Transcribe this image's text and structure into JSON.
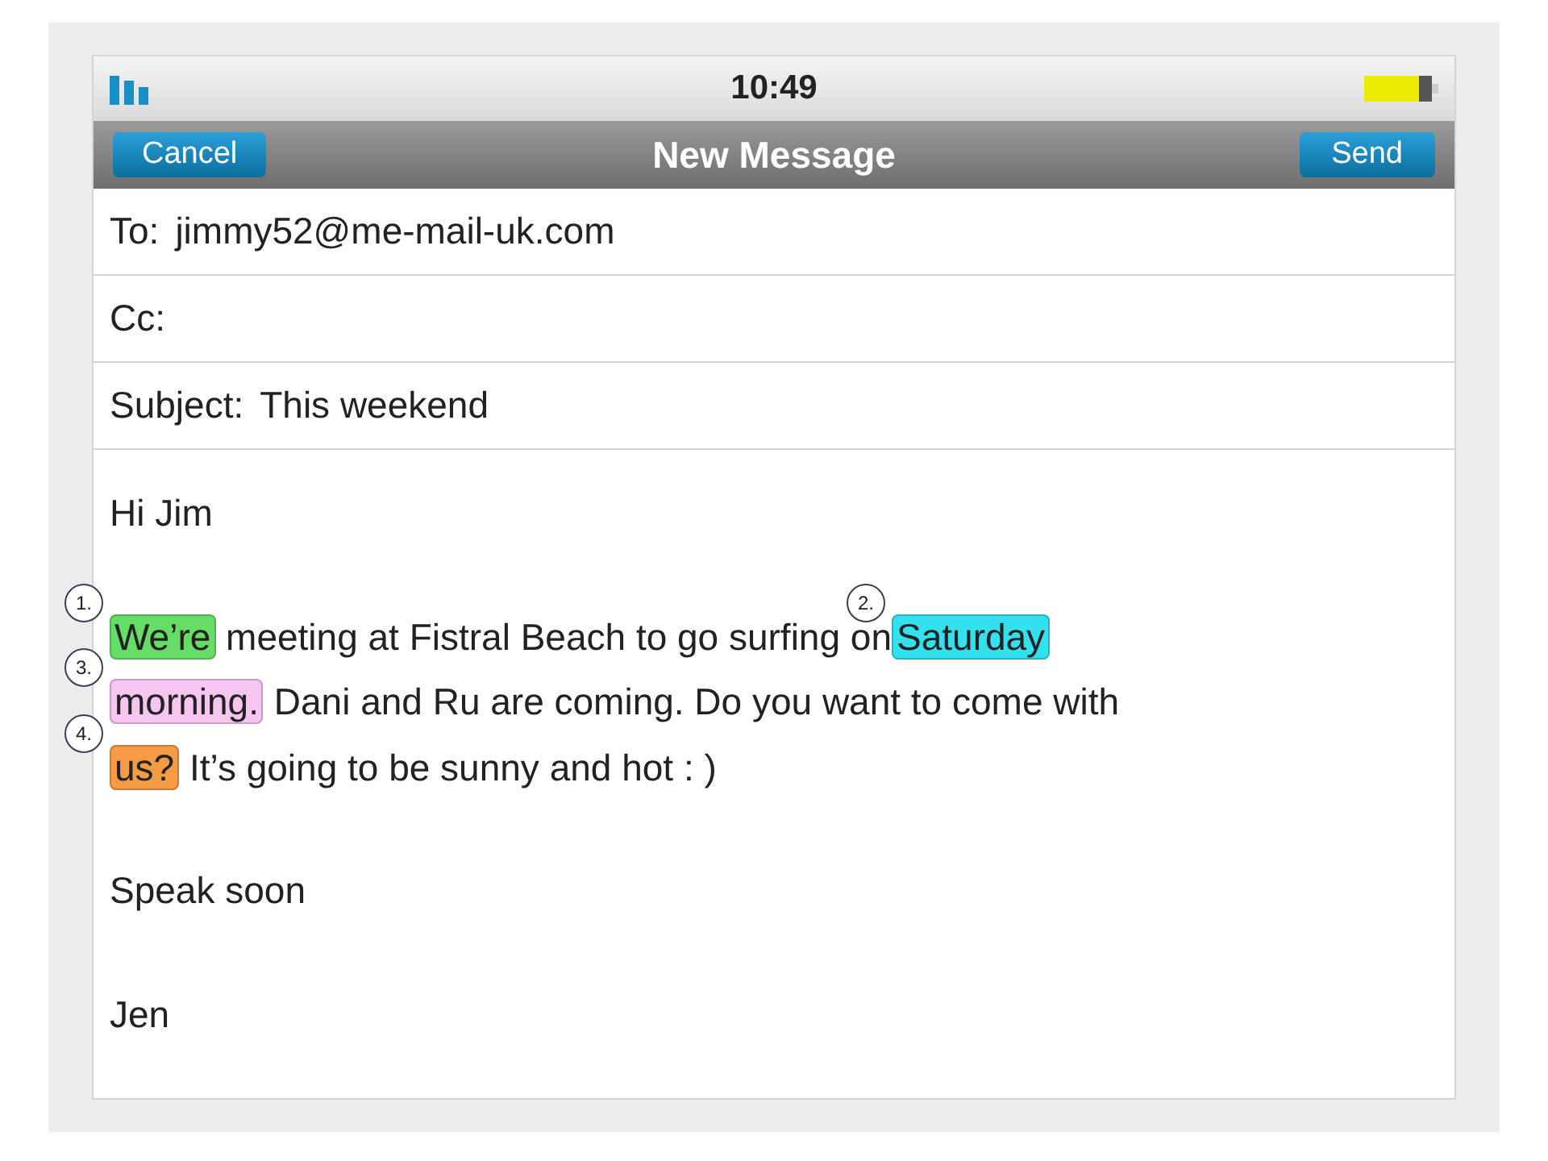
{
  "status_bar": {
    "time": "10:49"
  },
  "header": {
    "title": "New Message",
    "cancel": "Cancel",
    "send": "Send"
  },
  "fields": [
    {
      "label": "To:",
      "value": "jimmy52@me-mail-uk.com"
    },
    {
      "label": "Cc:"
    },
    {
      "label": "Subject:",
      "value": "This weekend"
    }
  ],
  "body": {
    "greeting": "Hi Jim",
    "lines": [
      [
        {
          "marker": "1.",
          "text": "We’re",
          "color": "#66dd66"
        },
        {
          "text": " meeting at Fistral Beach to go surfing on"
        },
        {
          "marker": "2.",
          "text": "Saturday",
          "color": "#33e0ee"
        }
      ],
      [
        {
          "marker": "3.",
          "text": "morning.",
          "color": "#f6c6f0"
        },
        {
          "text": " Dani and Ru are coming. Do you want to come with"
        }
      ],
      [
        {
          "marker": "4.",
          "text": "us?",
          "color": "#f59a45"
        },
        {
          "text": " It’s going to be sunny and hot : )"
        }
      ]
    ],
    "closing": "Speak soon",
    "signature": "Jen"
  }
}
